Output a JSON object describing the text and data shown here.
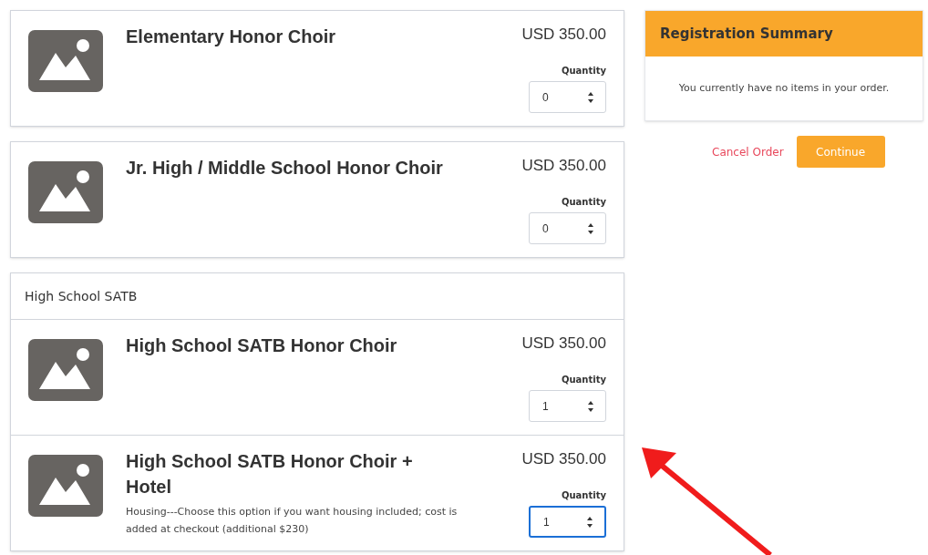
{
  "products": [
    {
      "kind": "card",
      "title": "Elementary Honor Choir",
      "price": "USD 350.00",
      "quantity_label": "Quantity",
      "quantity": "0",
      "focused": false
    },
    {
      "kind": "card",
      "title": "Jr. High / Middle School Honor Choir",
      "price": "USD 350.00",
      "quantity_label": "Quantity",
      "quantity": "0",
      "focused": false
    },
    {
      "kind": "group",
      "heading": "High School SATB",
      "items": [
        {
          "title": "High School SATB Honor Choir",
          "price": "USD 350.00",
          "quantity_label": "Quantity",
          "quantity": "1",
          "focused": false
        },
        {
          "title": "High School SATB Honor Choir + Hotel",
          "description": "Housing---Choose this option if you want housing included; cost is added at checkout (additional $230)",
          "price": "USD 350.00",
          "quantity_label": "Quantity",
          "quantity": "1",
          "focused": true
        }
      ]
    }
  ],
  "summary": {
    "title": "Registration Summary",
    "message": "You currently have no items in your order."
  },
  "actions": {
    "cancel": "Cancel Order",
    "continue": "Continue"
  }
}
